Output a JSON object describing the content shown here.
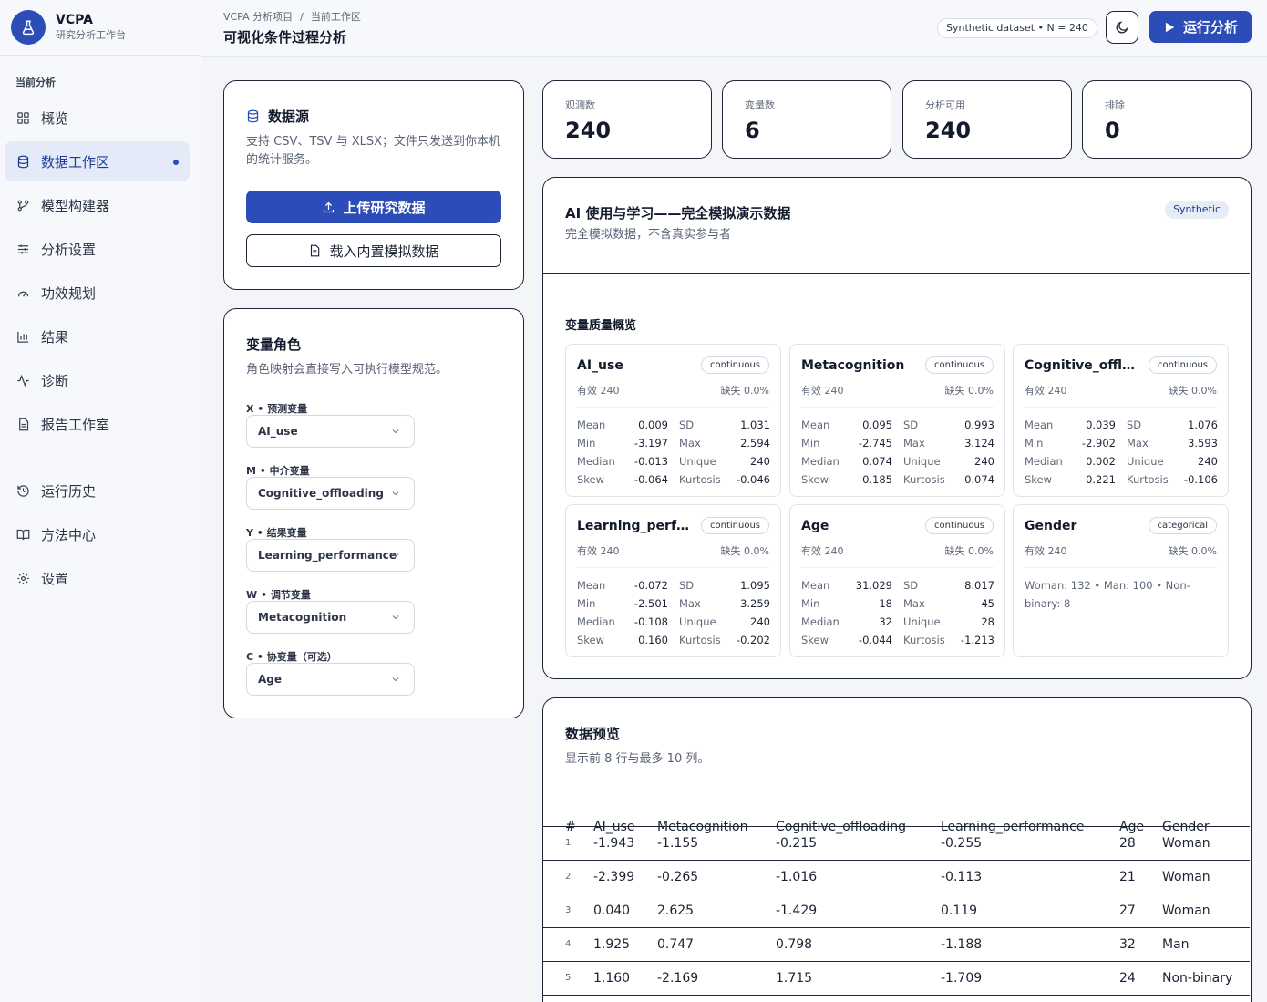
{
  "brand": {
    "name": "VCPA",
    "subtitle": "研究分析工作台"
  },
  "nav": {
    "section": "当前分析",
    "items": [
      {
        "label": "概览",
        "icon": "grid-icon"
      },
      {
        "label": "数据工作区",
        "icon": "database-icon",
        "active": true
      },
      {
        "label": "模型构建器",
        "icon": "branch-icon"
      },
      {
        "label": "分析设置",
        "icon": "sliders-icon"
      },
      {
        "label": "功效规划",
        "icon": "gauge-icon"
      },
      {
        "label": "结果",
        "icon": "bar-chart-icon"
      },
      {
        "label": "诊断",
        "icon": "activity-icon"
      },
      {
        "label": "报告工作室",
        "icon": "document-icon"
      }
    ],
    "items2": [
      {
        "label": "运行历史",
        "icon": "history-icon"
      },
      {
        "label": "方法中心",
        "icon": "book-icon"
      },
      {
        "label": "设置",
        "icon": "gear-icon"
      }
    ]
  },
  "header": {
    "crumb1": "VCPA 分析项目",
    "crumb_sep": "/",
    "crumb2": "当前工作区",
    "title": "可视化条件过程分析",
    "dataset_badge": "Synthetic dataset • N = 240",
    "run_label": "运行分析"
  },
  "datasource": {
    "title": "数据源",
    "desc": "支持 CSV、TSV 与 XLSX；文件只发送到你本机的统计服务。",
    "upload_label": "上传研究数据",
    "load_label": "载入内置模拟数据"
  },
  "roles": {
    "title": "变量角色",
    "desc": "角色映射会直接写入可执行模型规范。",
    "items": [
      {
        "label": "X • 预测变量",
        "value": "AI_use"
      },
      {
        "label": "M • 中介变量",
        "value": "Cognitive_offloading"
      },
      {
        "label": "Y • 结果变量",
        "value": "Learning_performance"
      },
      {
        "label": "W • 调节变量",
        "value": "Metacognition"
      },
      {
        "label": "C • 协变量（可选）",
        "value": "Age"
      }
    ]
  },
  "stats": [
    {
      "label": "观测数",
      "value": "240"
    },
    {
      "label": "变量数",
      "value": "6"
    },
    {
      "label": "分析可用",
      "value": "240"
    },
    {
      "label": "排除",
      "value": "0"
    }
  ],
  "dataset": {
    "title": "AI 使用与学习——完全模拟演示数据",
    "desc": "完全模拟数据，不含真实参与者",
    "chip": "Synthetic",
    "quality_title": "变量质量概览"
  },
  "stat_labels": {
    "mean": "Mean",
    "sd": "SD",
    "min": "Min",
    "max": "Max",
    "median": "Median",
    "unique": "Unique",
    "skew": "Skew",
    "kurtosis": "Kurtosis"
  },
  "variables": [
    {
      "name": "AI_use",
      "type": "continuous",
      "valid": "有效 240",
      "missing": "缺失 0.0%",
      "mean": "0.009",
      "sd": "1.031",
      "min": "-3.197",
      "max": "2.594",
      "median": "-0.013",
      "unique": "240",
      "skew": "-0.064",
      "kurtosis": "-0.046"
    },
    {
      "name": "Metacognition",
      "type": "continuous",
      "valid": "有效 240",
      "missing": "缺失 0.0%",
      "mean": "0.095",
      "sd": "0.993",
      "min": "-2.745",
      "max": "3.124",
      "median": "0.074",
      "unique": "240",
      "skew": "0.185",
      "kurtosis": "0.074"
    },
    {
      "name": "Cognitive_offloading",
      "type": "continuous",
      "valid": "有效 240",
      "missing": "缺失 0.0%",
      "mean": "0.039",
      "sd": "1.076",
      "min": "-2.902",
      "max": "3.593",
      "median": "0.002",
      "unique": "240",
      "skew": "0.221",
      "kurtosis": "-0.106"
    },
    {
      "name": "Learning_performance",
      "type": "continuous",
      "valid": "有效 240",
      "missing": "缺失 0.0%",
      "mean": "-0.072",
      "sd": "1.095",
      "min": "-2.501",
      "max": "3.259",
      "median": "-0.108",
      "unique": "240",
      "skew": "0.160",
      "kurtosis": "-0.202"
    },
    {
      "name": "Age",
      "type": "continuous",
      "valid": "有效 240",
      "missing": "缺失 0.0%",
      "mean": "31.029",
      "sd": "8.017",
      "min": "18",
      "max": "45",
      "median": "32",
      "unique": "28",
      "skew": "-0.044",
      "kurtosis": "-1.213"
    },
    {
      "name": "Gender",
      "type": "categorical",
      "valid": "有效 240",
      "missing": "缺失 0.0%",
      "summary": "Woman: 132 • Man: 100 • Non-binary: 8"
    }
  ],
  "preview": {
    "title": "数据预览",
    "desc": "显示前 8 行与最多 10 列。",
    "columns": [
      "#",
      "AI_use",
      "Metacognition",
      "Cognitive_offloading",
      "Learning_performance",
      "Age",
      "Gender"
    ],
    "rows": [
      [
        "1",
        "-1.943",
        "-1.155",
        "-0.215",
        "-0.255",
        "28",
        "Woman"
      ],
      [
        "2",
        "-2.399",
        "-0.265",
        "-1.016",
        "-0.113",
        "21",
        "Woman"
      ],
      [
        "3",
        "0.040",
        "2.625",
        "-1.429",
        "0.119",
        "27",
        "Woman"
      ],
      [
        "4",
        "1.925",
        "0.747",
        "0.798",
        "-1.188",
        "32",
        "Man"
      ],
      [
        "5",
        "1.160",
        "-2.169",
        "1.715",
        "-1.709",
        "24",
        "Non-binary"
      ]
    ]
  },
  "colors": {
    "accent": "#2c4cb8",
    "border": "#1d2535",
    "chip_bg": "#e8ecf7"
  }
}
